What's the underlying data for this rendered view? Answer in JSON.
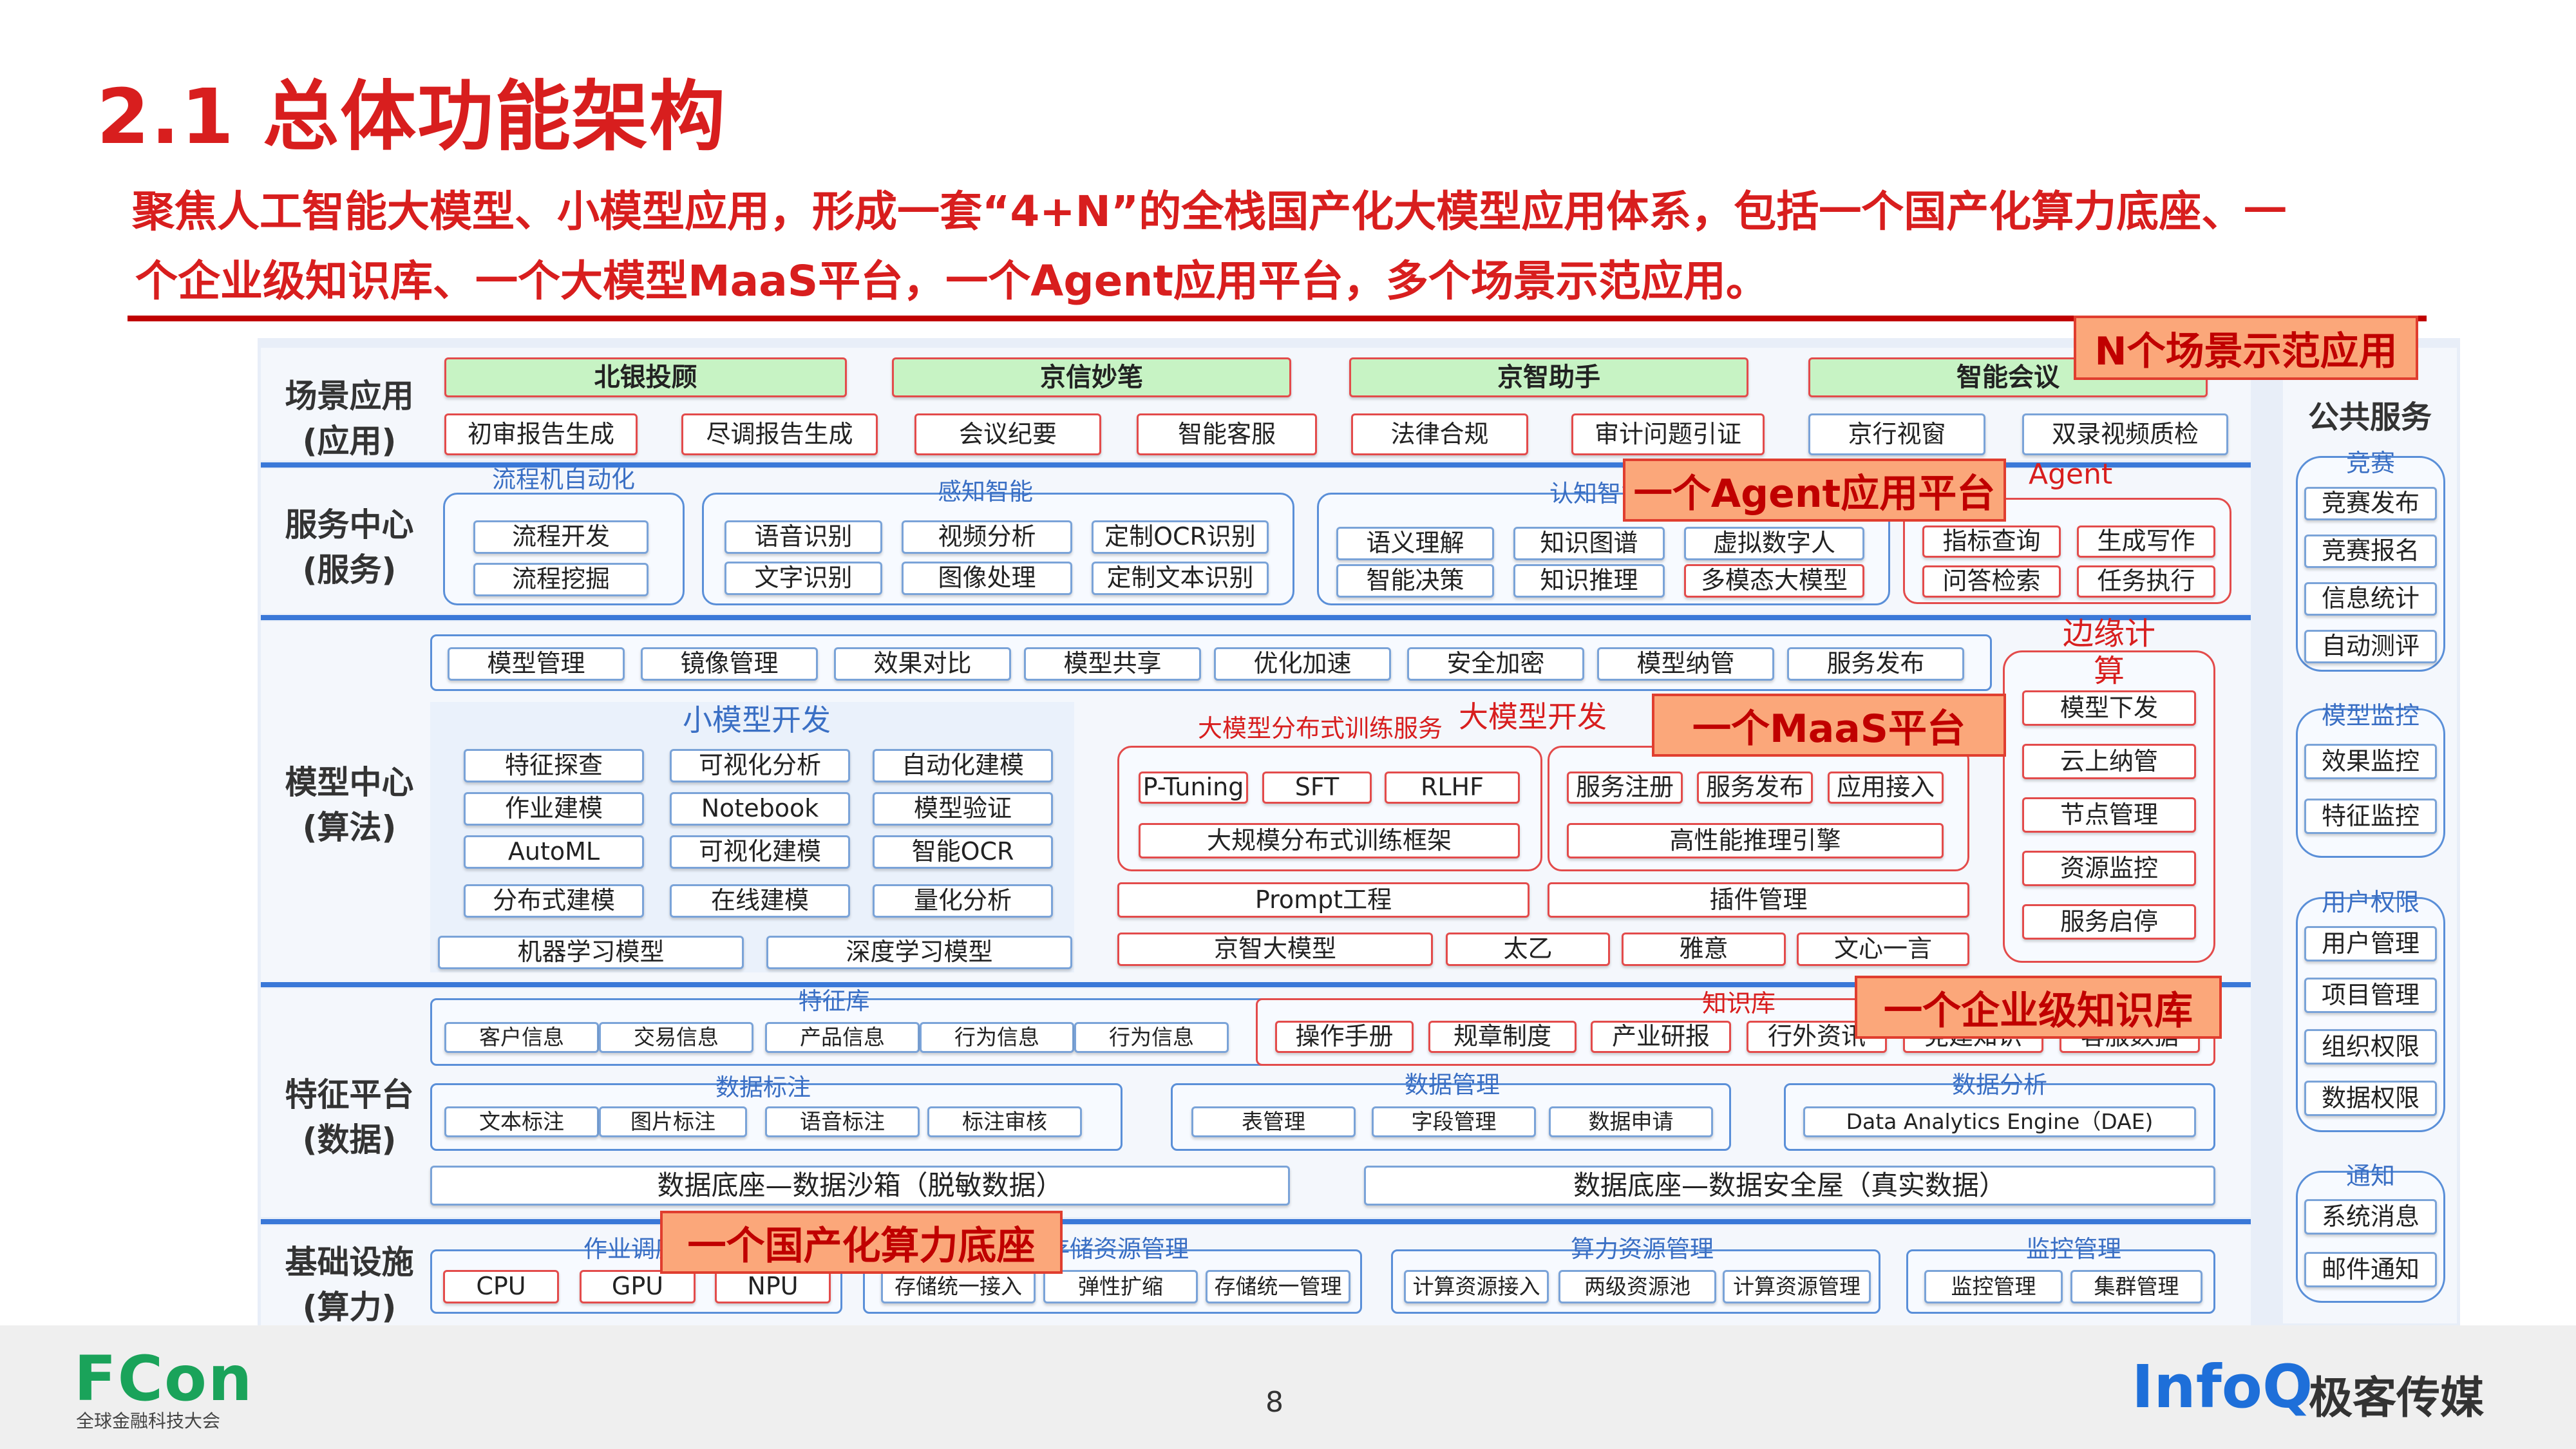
{
  "title": "2.1  总体功能架构",
  "intro_line1": "聚焦人工智能大模型、小模型应用，形成一套“4+N”的全栈国产化大模型应用体系，包括一个国产化算力底座、一",
  "intro_line2": "个企业级知识库、一个大模型MaaS平台，一个Agent应用平台，多个场景示范应用。",
  "rows": {
    "scene": "场景应用\n(应用)",
    "service": "服务中心\n(服务)",
    "model": "模型中心\n(算法)",
    "feature": "特征平台\n(数据)",
    "infra": "基础设施\n(算力)"
  },
  "scene": {
    "headers": [
      "北银投顾",
      "京信妙笔",
      "京智助手",
      "智能会议"
    ],
    "items": [
      "初审报告生成",
      "尽调报告生成",
      "会议纪要",
      "智能客服",
      "法律合规",
      "审计问题引证",
      "京行视窗",
      "双录视频质检"
    ]
  },
  "service": {
    "process_title": "流程机自动化",
    "process_items": [
      "流程开发",
      "流程挖掘"
    ],
    "percept_title": "感知智能",
    "percept_items": [
      "语音识别",
      "视频分析",
      "定制OCR识别",
      "文字识别",
      "图像处理",
      "定制文本识别"
    ],
    "cog_title": "认知智能",
    "cog_items": [
      "语义理解",
      "知识图谱",
      "虚拟数字人",
      "智能决策",
      "知识推理",
      "多模态大模型"
    ],
    "agent_title": "Agent",
    "agent_items": [
      "指标查询",
      "生成写作",
      "问答检索",
      "任务执行"
    ]
  },
  "model": {
    "mgmt_items": [
      "模型管理",
      "镜像管理",
      "效果对比",
      "模型共享",
      "优化加速",
      "安全加密",
      "模型纳管",
      "服务发布"
    ],
    "small_title": "小模型开发",
    "small_items": [
      "特征探查",
      "可视化分析",
      "自动化建模",
      "作业建模",
      "Notebook",
      "模型验证",
      "AutoML",
      "可视化建模",
      "智能OCR",
      "分布式建模",
      "在线建模",
      "量化分析"
    ],
    "ml_items": [
      "机器学习模型",
      "深度学习模型"
    ],
    "large_title": "大模型开发",
    "train_title": "大模型分布式训练服务",
    "train_items": [
      "P-Tuning",
      "SFT",
      "RLHF"
    ],
    "train_framework": "大规模分布式训练框架",
    "infer_items": [
      "服务注册",
      "服务发布",
      "应用接入"
    ],
    "infer_engine": "高性能推理引擎",
    "prompt": "Prompt工程",
    "plugin": "插件管理",
    "llms": [
      "京智大模型",
      "太乙",
      "雅意",
      "文心一言"
    ],
    "edge_title": "边缘计算",
    "edge_items": [
      "模型下发",
      "云上纳管",
      "节点管理",
      "资源监控",
      "服务启停"
    ]
  },
  "feature": {
    "fstore_title": "特征库",
    "fstore_items": [
      "客户信息",
      "交易信息",
      "产品信息",
      "行为信息",
      "行为信息"
    ],
    "kb_title": "知识库",
    "kb_items": [
      "操作手册",
      "规章制度",
      "产业研报",
      "行外资讯",
      "党建知识",
      "客服数据"
    ],
    "label_title": "数据标注",
    "label_items": [
      "文本标注",
      "图片标注",
      "语音标注",
      "标注审核"
    ],
    "dm_title": "数据管理",
    "dm_items": [
      "表管理",
      "字段管理",
      "数据申请"
    ],
    "da_title": "数据分析",
    "da_items": [
      "Data Analytics Engine（DAE)"
    ],
    "sandbox": "数据底座—数据沙箱（脱敏数据）",
    "vault": "数据底座—数据安全屋（真实数据）"
  },
  "infra": {
    "job_title": "作业调度",
    "job_items": [
      "CPU",
      "GPU",
      "NPU"
    ],
    "storage_title": "存储资源管理",
    "storage_items": [
      "存储统一接入",
      "弹性扩缩",
      "存储统一管理"
    ],
    "compute_title": "算力资源管理",
    "compute_items": [
      "计算资源接入",
      "两级资源池",
      "计算资源管理"
    ],
    "monitor_title": "监控管理",
    "monitor_items": [
      "监控管理",
      "集群管理"
    ]
  },
  "public": {
    "title": "公共服务",
    "groups": [
      {
        "title": "竞赛",
        "items": [
          "竞赛发布",
          "竞赛报名",
          "信息统计",
          "自动测评"
        ]
      },
      {
        "title": "模型监控",
        "items": [
          "效果监控",
          "特征监控"
        ]
      },
      {
        "title": "用户权限",
        "items": [
          "用户管理",
          "项目管理",
          "组织权限",
          "数据权限"
        ]
      },
      {
        "title": "通知",
        "items": [
          "系统消息",
          "邮件通知"
        ]
      }
    ]
  },
  "overlays": {
    "scenes": "N个场景示范应用",
    "agent": "一个Agent应用平台",
    "maas": "一个MaaS平台",
    "kb": "一个企业级知识库",
    "compute": "一个国产化算力底座"
  },
  "footer": {
    "brand": "FCon",
    "brand_sub": "全球金融科技大会",
    "page": "8",
    "infoq": "InfoQ",
    "jike": "极客传媒"
  }
}
